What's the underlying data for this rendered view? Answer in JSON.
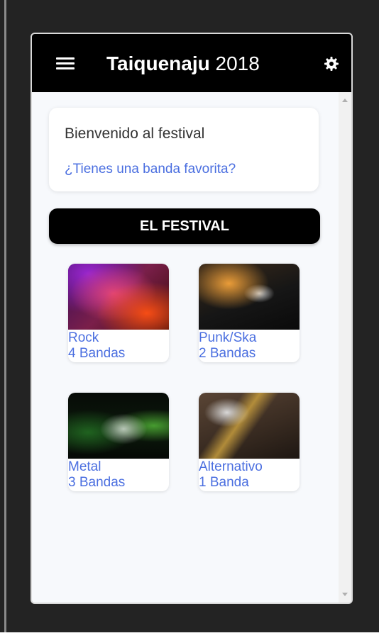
{
  "app": {
    "title_bold": "Taiquenaju",
    "title_year": "2018",
    "menu_icon": "hamburger-menu-icon",
    "settings_icon": "settings-gear-icon"
  },
  "welcome": {
    "text": "Bienvenido al festival",
    "link": "¿Tienes una banda favorita?"
  },
  "festival_button": "EL FESTIVAL",
  "genres": [
    {
      "name": "Rock",
      "count": "4 Bandas"
    },
    {
      "name": "Punk/Ska",
      "count": "2 Bandas"
    },
    {
      "name": "Metal",
      "count": "3 Bandas"
    },
    {
      "name": "Alternativo",
      "count": "1 Banda"
    }
  ],
  "colors": {
    "appbar": "#000000",
    "link": "#4b6fe0",
    "background": "#f7f9fc"
  }
}
